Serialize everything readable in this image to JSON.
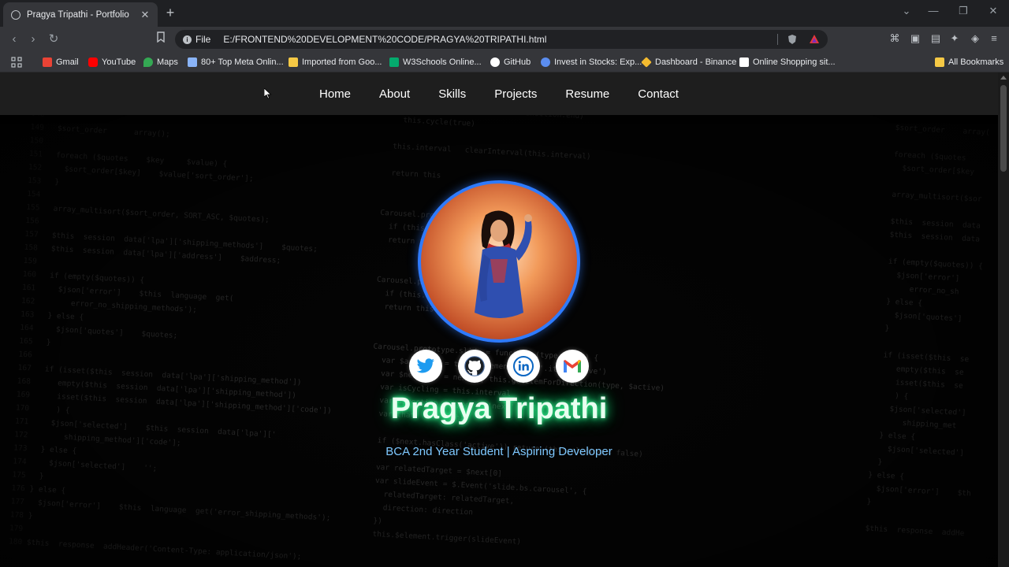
{
  "browser": {
    "tab": {
      "title": "Pragya Tripathi - Portfolio",
      "close": "✕"
    },
    "new_tab": "+",
    "window": {
      "dropdown": "⌄",
      "minimize": "—",
      "restore": "❐",
      "close": "✕"
    },
    "address": {
      "scheme": "File",
      "url": "E:/FRONTEND%20DEVELOPMENT%20CODE/PRAGYA%20TRIPATHI.html"
    },
    "bookmarks": [
      {
        "label": "Gmail",
        "color": "#ea4335"
      },
      {
        "label": "YouTube",
        "color": "#ff0000"
      },
      {
        "label": "Maps",
        "color": "#34a853"
      },
      {
        "label": "80+ Top Meta Onlin...",
        "color": "#8ab4f8"
      },
      {
        "label": "Imported from Goo...",
        "color": "#f6c945"
      },
      {
        "label": "W3Schools Online...",
        "color": "#04aa6d"
      },
      {
        "label": "GitHub",
        "color": "#ffffff"
      },
      {
        "label": "Invest in Stocks: Exp...",
        "color": "#5b8def"
      },
      {
        "label": "Dashboard - Binance",
        "color": "#f3ba2f"
      },
      {
        "label": "Online Shopping sit...",
        "color": "#ffffff"
      }
    ],
    "all_bookmarks": "All Bookmarks"
  },
  "site": {
    "nav": [
      "Home",
      "About",
      "Skills",
      "Projects",
      "Resume",
      "Contact"
    ],
    "socials": [
      {
        "name": "twitter",
        "color": "#1d9bf0"
      },
      {
        "name": "github",
        "color": "#1b1f23"
      },
      {
        "name": "linkedin",
        "color": "#0a66c2"
      },
      {
        "name": "gmail",
        "color": "#ea4335"
      }
    ],
    "name": "Pragya Tripathi",
    "tagline": "BCA 2nd Year Student | Aspiring Developer",
    "colors": {
      "accent_ring": "#2f7bff",
      "name_glow": "#39ff9a",
      "tagline": "#7ec8ff"
    }
  }
}
